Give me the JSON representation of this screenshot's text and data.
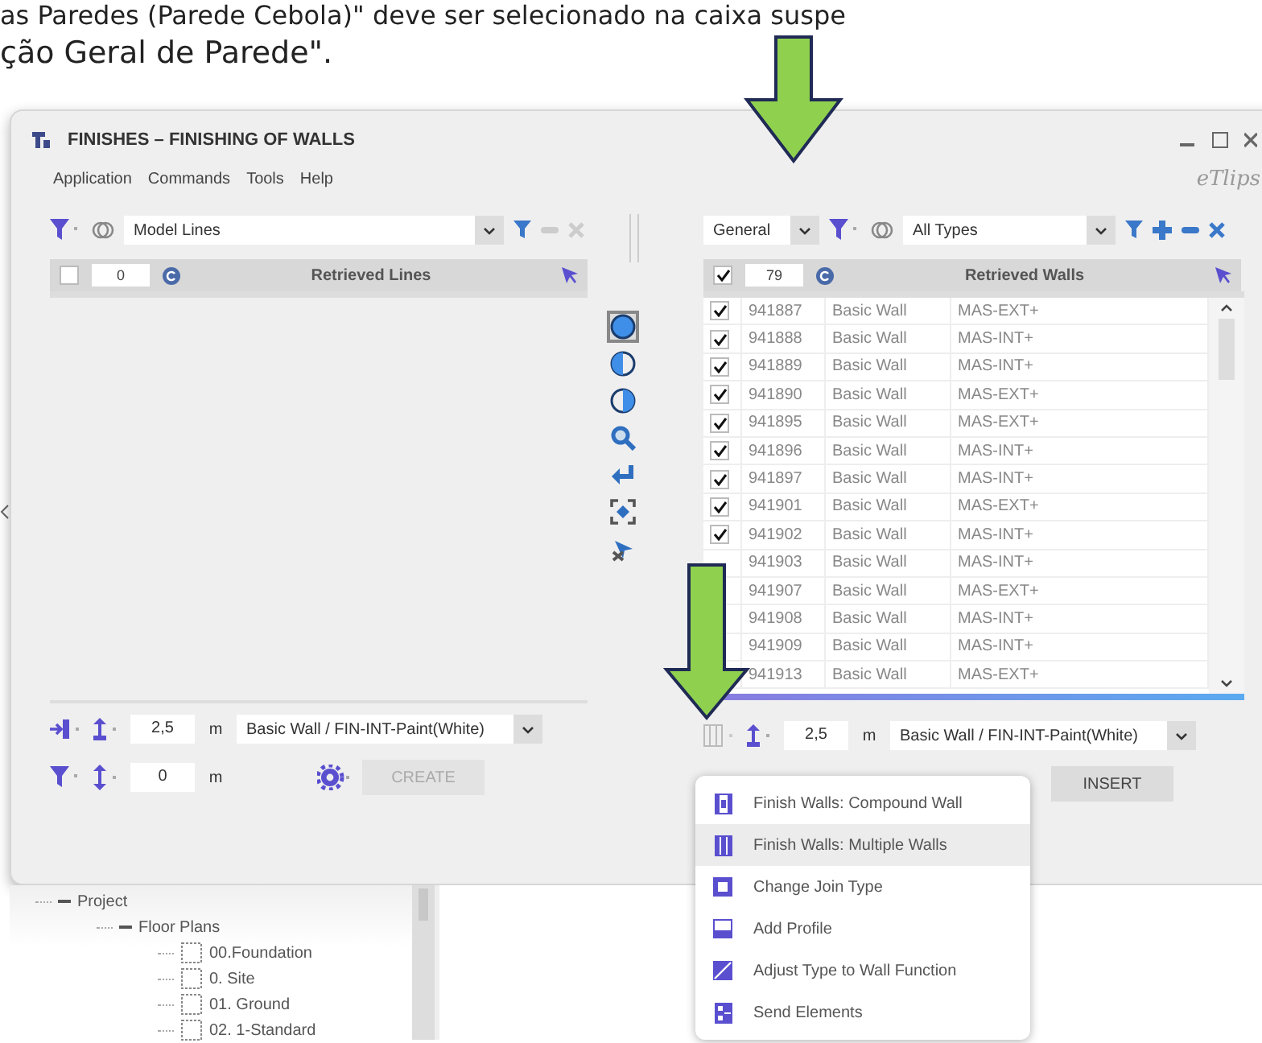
{
  "caption": {
    "lines": [
      "as Paredes (Parede Cebola)\" deve ser selecionado na caixa suspe",
      "ção Geral de Parede\"."
    ]
  },
  "window": {
    "title": "FINISHES – FINISHING OF WALLS",
    "logo": "eTlips"
  },
  "menu": [
    "Application",
    "Commands",
    "Tools",
    "Help"
  ],
  "left_panel": {
    "filter": "Model Lines",
    "header": {
      "checked": false,
      "count": "0",
      "title": "Retrieved Lines"
    },
    "height": {
      "value": "2,5",
      "unit": "m"
    },
    "type": "Basic Wall / FIN-INT-Paint(White)",
    "offset": {
      "value": "0",
      "unit": "m"
    },
    "button": {
      "label": "CREATE",
      "disabled": true
    }
  },
  "tools": [
    {
      "kind": "full",
      "selected": true
    },
    {
      "kind": "left",
      "selected": false
    },
    {
      "kind": "right",
      "selected": false
    },
    {
      "kind": "zoom",
      "selected": false
    },
    {
      "kind": "return",
      "selected": false
    },
    {
      "kind": "focus",
      "selected": false
    },
    {
      "kind": "cursor",
      "selected": false
    }
  ],
  "right_panel": {
    "category": "General",
    "filter": "All Types",
    "header": {
      "checked": true,
      "count": "79",
      "title": "Retrieved Walls"
    },
    "rows": [
      {
        "id": "941887",
        "type": "Basic Wall",
        "name": "MAS-EXT+",
        "checked": true
      },
      {
        "id": "941888",
        "type": "Basic Wall",
        "name": "MAS-INT+",
        "checked": true
      },
      {
        "id": "941889",
        "type": "Basic Wall",
        "name": "MAS-INT+",
        "checked": true
      },
      {
        "id": "941890",
        "type": "Basic Wall",
        "name": "MAS-EXT+",
        "checked": true
      },
      {
        "id": "941895",
        "type": "Basic Wall",
        "name": "MAS-EXT+",
        "checked": true
      },
      {
        "id": "941896",
        "type": "Basic Wall",
        "name": "MAS-INT+",
        "checked": true
      },
      {
        "id": "941897",
        "type": "Basic Wall",
        "name": "MAS-INT+",
        "checked": true
      },
      {
        "id": "941901",
        "type": "Basic Wall",
        "name": "MAS-EXT+",
        "checked": true
      },
      {
        "id": "941902",
        "type": "Basic Wall",
        "name": "MAS-INT+",
        "checked": true
      },
      {
        "id": "941903",
        "type": "Basic Wall",
        "name": "MAS-INT+"
      },
      {
        "id": "941907",
        "type": "Basic Wall",
        "name": "MAS-EXT+"
      },
      {
        "id": "941908",
        "type": "Basic Wall",
        "name": "MAS-INT+"
      },
      {
        "id": "941909",
        "type": "Basic Wall",
        "name": "MAS-INT+"
      },
      {
        "id": "941913",
        "type": "Basic Wall",
        "name": "MAS-EXT+"
      }
    ],
    "height": {
      "value": "2,5",
      "unit": "m"
    },
    "type": "Basic Wall / FIN-INT-Paint(White)",
    "button": {
      "label": "INSERT",
      "disabled": false
    }
  },
  "dropdown_menu": [
    {
      "label": "Finish Walls: Compound Wall",
      "kind": "compound",
      "selected": false
    },
    {
      "label": "Finish Walls: Multiple Walls",
      "kind": "multiple",
      "selected": true
    },
    {
      "label": "Change Join Type",
      "kind": "join",
      "selected": false
    },
    {
      "label": "Add Profile",
      "kind": "profile",
      "selected": false
    },
    {
      "label": "Adjust Type to Wall Function",
      "kind": "adjust",
      "selected": false
    },
    {
      "label": "Send Elements",
      "kind": "send",
      "selected": false
    }
  ],
  "tree": [
    {
      "label": "Project",
      "expanded": true,
      "children": [
        {
          "label": "Floor Plans",
          "expanded": true,
          "children": [
            {
              "label": "00.Foundation"
            },
            {
              "label": "0. Site"
            },
            {
              "label": "01. Ground"
            },
            {
              "label": "02. 1-Standard"
            }
          ]
        }
      ]
    }
  ]
}
